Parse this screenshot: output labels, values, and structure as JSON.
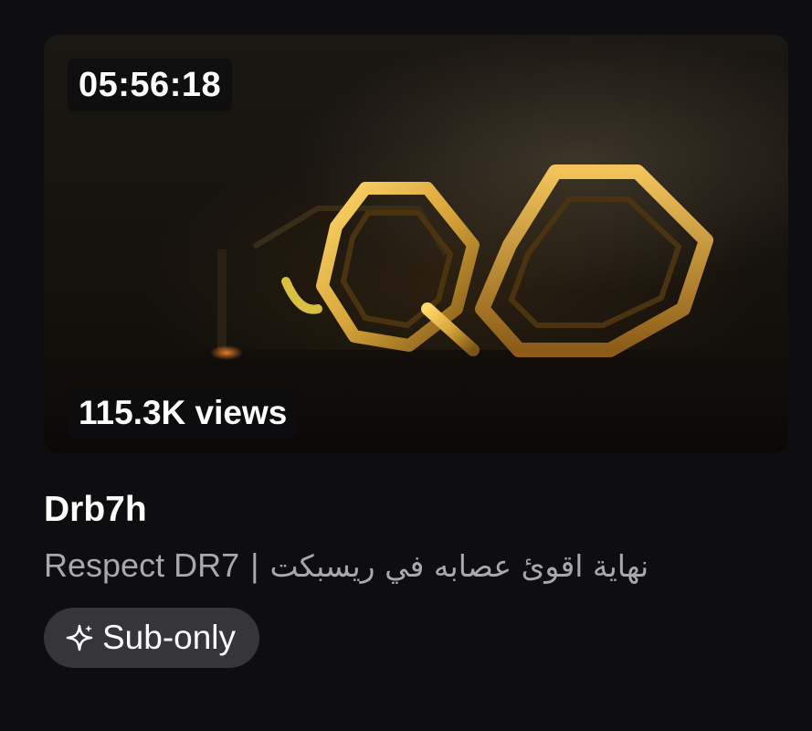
{
  "video": {
    "duration": "05:56:18",
    "views": "115.3K views",
    "channel": "Drb7h",
    "title_en": "Respect DR7",
    "separator": "|",
    "title_ar": "نهاية اقوئ عصابه في ريسبكت",
    "badge": {
      "label": "Sub-only",
      "icon": "sparkle-icon"
    }
  },
  "colors": {
    "background": "#0e0e10",
    "subtitle": "#a8a8ad",
    "chip_bg": "#35353a",
    "logo_gold": "#d9a53a"
  }
}
